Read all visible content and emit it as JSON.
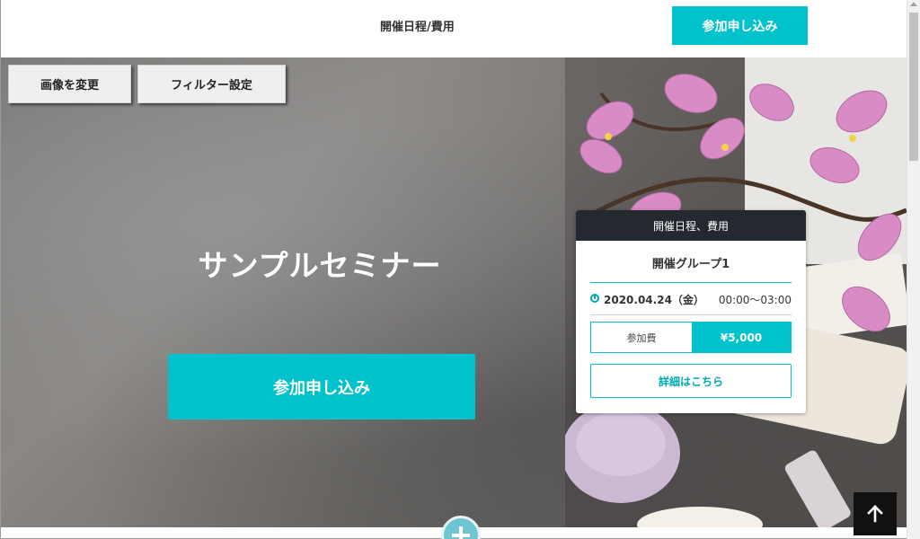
{
  "header": {
    "nav_link": "開催日程/費用",
    "cta_label": "参加申し込み"
  },
  "toolbar": {
    "change_image_label": "画像を変更",
    "filter_settings_label": "フィルター設定"
  },
  "hero": {
    "title": "サンプルセミナー",
    "cta_label": "参加申し込み"
  },
  "schedule_card": {
    "header": "開催日程、費用",
    "group_name": "開催グループ1",
    "date": "2020.04.24（金）",
    "time": "00:00～03:00",
    "fee_label": "参加費",
    "fee_value": "¥5,000",
    "detail_button": "詳細はこちら"
  },
  "icons": {
    "clock": "clock-icon",
    "back_to_top": "arrow-up-icon",
    "add_section": "plus-icon"
  },
  "colors": {
    "accent": "#00c2cc",
    "card_header": "#23292e",
    "to_top_bg": "#111111"
  }
}
